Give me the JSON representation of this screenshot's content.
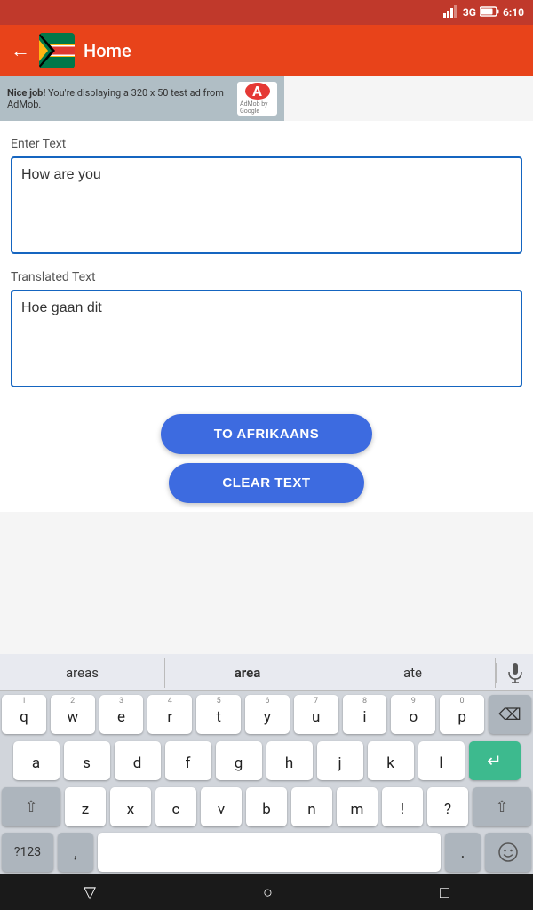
{
  "statusBar": {
    "signal": "3G",
    "time": "6:10"
  },
  "topBar": {
    "title": "Home",
    "backLabel": "←"
  },
  "ad": {
    "text_strong": "Nice job!",
    "text_rest": " You're displaying a 320 x 50 test ad from AdMob.",
    "admob_label": "A",
    "admob_byline": "AdMob by Google"
  },
  "enterTextLabel": "Enter Text",
  "inputText": "How are you",
  "translatedTextLabel": "Translated Text",
  "translatedText": "Hoe gaan dit",
  "buttons": {
    "toAfrikaans": "TO AFRIKAANS",
    "clearText": "CLEAR TEXT"
  },
  "keyboard": {
    "suggestions": [
      "areas",
      "area",
      "ate"
    ],
    "rows": [
      [
        {
          "num": "1",
          "letter": "q"
        },
        {
          "num": "2",
          "letter": "w"
        },
        {
          "num": "3",
          "letter": "e"
        },
        {
          "num": "4",
          "letter": "r"
        },
        {
          "num": "5",
          "letter": "t"
        },
        {
          "num": "6",
          "letter": "y"
        },
        {
          "num": "7",
          "letter": "u"
        },
        {
          "num": "8",
          "letter": "i"
        },
        {
          "num": "9",
          "letter": "o"
        },
        {
          "num": "0",
          "letter": "p"
        }
      ],
      [
        {
          "letter": "a"
        },
        {
          "letter": "s"
        },
        {
          "letter": "d"
        },
        {
          "letter": "f"
        },
        {
          "letter": "g"
        },
        {
          "letter": "h"
        },
        {
          "letter": "j"
        },
        {
          "letter": "k"
        },
        {
          "letter": "l"
        }
      ],
      [
        {
          "letter": "z"
        },
        {
          "letter": "x"
        },
        {
          "letter": "c"
        },
        {
          "letter": "v"
        },
        {
          "letter": "b"
        },
        {
          "letter": "n"
        },
        {
          "letter": "m"
        },
        {
          "letter": "!"
        },
        {
          "letter": "?"
        }
      ]
    ],
    "numSymLabel": "?123",
    "commaLabel": ",",
    "periodLabel": ".",
    "deleteLabel": "⌫",
    "enterLabel": "↵"
  },
  "navBar": {
    "back": "▽",
    "home": "○",
    "recent": "□"
  }
}
